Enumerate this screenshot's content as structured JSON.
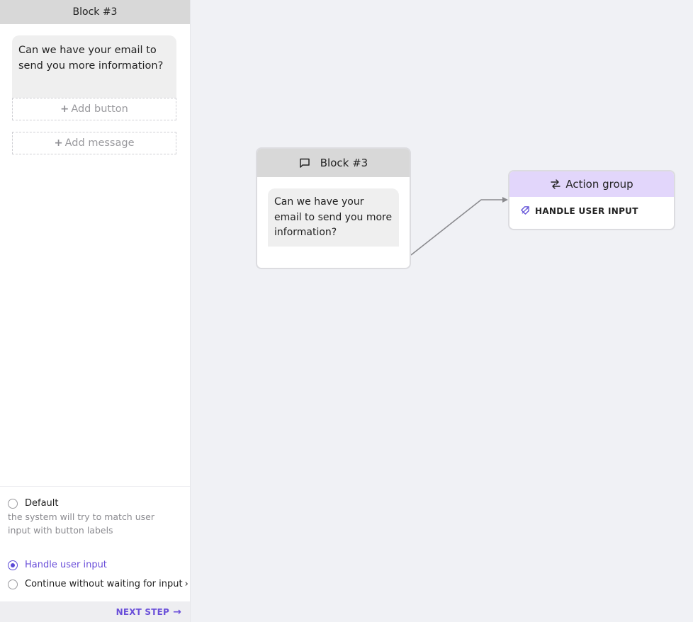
{
  "panel": {
    "title": "Block #3",
    "message_text": "Can we have your email to send you more information?",
    "add_button_label": "Add button",
    "add_message_label": "Add message",
    "options": {
      "default_label": "Default",
      "default_hint": "the system will try to match user input with button labels",
      "handle_input_label": "Handle user input",
      "continue_label": "Continue without waiting for input",
      "selected": "Handle user input"
    },
    "next_step_label": "NEXT STEP"
  },
  "canvas": {
    "block_node": {
      "title": "Block #3",
      "message_text": "Can we have your email to send you more information?",
      "icon": "chat-bubble-icon"
    },
    "action_node": {
      "title": "Action group",
      "icon": "arrows-exchange-icon",
      "item_label": "HANDLE USER INPUT",
      "item_icon": "tag-handle-icon"
    }
  },
  "colors": {
    "accent": "#6a4fd9",
    "action_header": "#e2d6fb",
    "block_header": "#d8d8d8",
    "canvas_bg": "#f0f1f5"
  }
}
